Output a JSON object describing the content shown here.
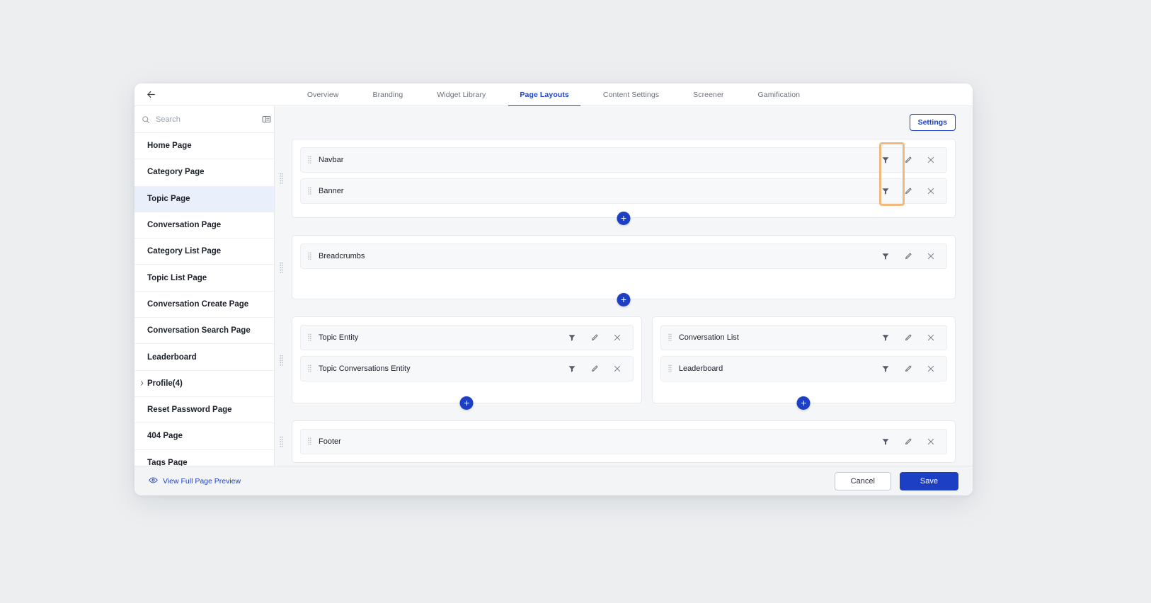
{
  "window": {
    "back_icon": "arrow-left-icon"
  },
  "tabs": [
    {
      "label": "Overview",
      "active": false
    },
    {
      "label": "Branding",
      "active": false
    },
    {
      "label": "Widget Library",
      "active": false
    },
    {
      "label": "Page Layouts",
      "active": true
    },
    {
      "label": "Content Settings",
      "active": false
    },
    {
      "label": "Screener",
      "active": false
    },
    {
      "label": "Gamification",
      "active": false
    }
  ],
  "sidebar": {
    "search": {
      "placeholder": "Search",
      "value": "",
      "icon": "search-icon",
      "panel_toggle_icon": "panel-layout-icon"
    },
    "items": [
      {
        "label": "Home Page",
        "active": false,
        "expandable": false
      },
      {
        "label": "Category Page",
        "active": false,
        "expandable": false
      },
      {
        "label": "Topic Page",
        "active": true,
        "expandable": false
      },
      {
        "label": "Conversation Page",
        "active": false,
        "expandable": false
      },
      {
        "label": "Category List Page",
        "active": false,
        "expandable": false
      },
      {
        "label": "Topic List Page",
        "active": false,
        "expandable": false
      },
      {
        "label": "Conversation Create Page",
        "active": false,
        "expandable": false
      },
      {
        "label": "Conversation Search Page",
        "active": false,
        "expandable": false
      },
      {
        "label": "Leaderboard",
        "active": false,
        "expandable": false
      },
      {
        "label": "Profile(4)",
        "active": false,
        "expandable": true
      },
      {
        "label": "Reset Password Page",
        "active": false,
        "expandable": false
      },
      {
        "label": "404 Page",
        "active": false,
        "expandable": false
      },
      {
        "label": "Tags Page",
        "active": false,
        "expandable": false
      }
    ]
  },
  "canvas": {
    "settings_label": "Settings",
    "add_label": "+",
    "row_actions": {
      "filter_icon": "filter-icon",
      "edit_icon": "pencil-icon",
      "remove_icon": "close-icon",
      "drag_icon": "drag-handle-icon"
    },
    "sections": [
      {
        "id": "section-header",
        "layout": "single",
        "rows": [
          {
            "label": "Navbar"
          },
          {
            "label": "Banner"
          }
        ]
      },
      {
        "id": "section-breadcrumbs",
        "layout": "single",
        "rows": [
          {
            "label": "Breadcrumbs"
          }
        ]
      },
      {
        "id": "section-main",
        "layout": "two-column",
        "left_rows": [
          {
            "label": "Topic Entity"
          },
          {
            "label": "Topic Conversations Entity"
          }
        ],
        "right_rows": [
          {
            "label": "Conversation List"
          },
          {
            "label": "Leaderboard"
          }
        ]
      },
      {
        "id": "section-footer",
        "layout": "single",
        "rows": [
          {
            "label": "Footer"
          }
        ]
      }
    ],
    "highlight": {
      "target": "filter-icon-column",
      "color": "#f2b97e"
    }
  },
  "footer": {
    "preview_label": "View Full Page Preview",
    "preview_icon": "eye-icon",
    "cancel_label": "Cancel",
    "save_label": "Save"
  },
  "colors": {
    "accent": "#1d3fc4",
    "highlight": "#f2b97e",
    "sidebar_active": "#e9effb",
    "canvas_bg": "#f5f6f8"
  }
}
